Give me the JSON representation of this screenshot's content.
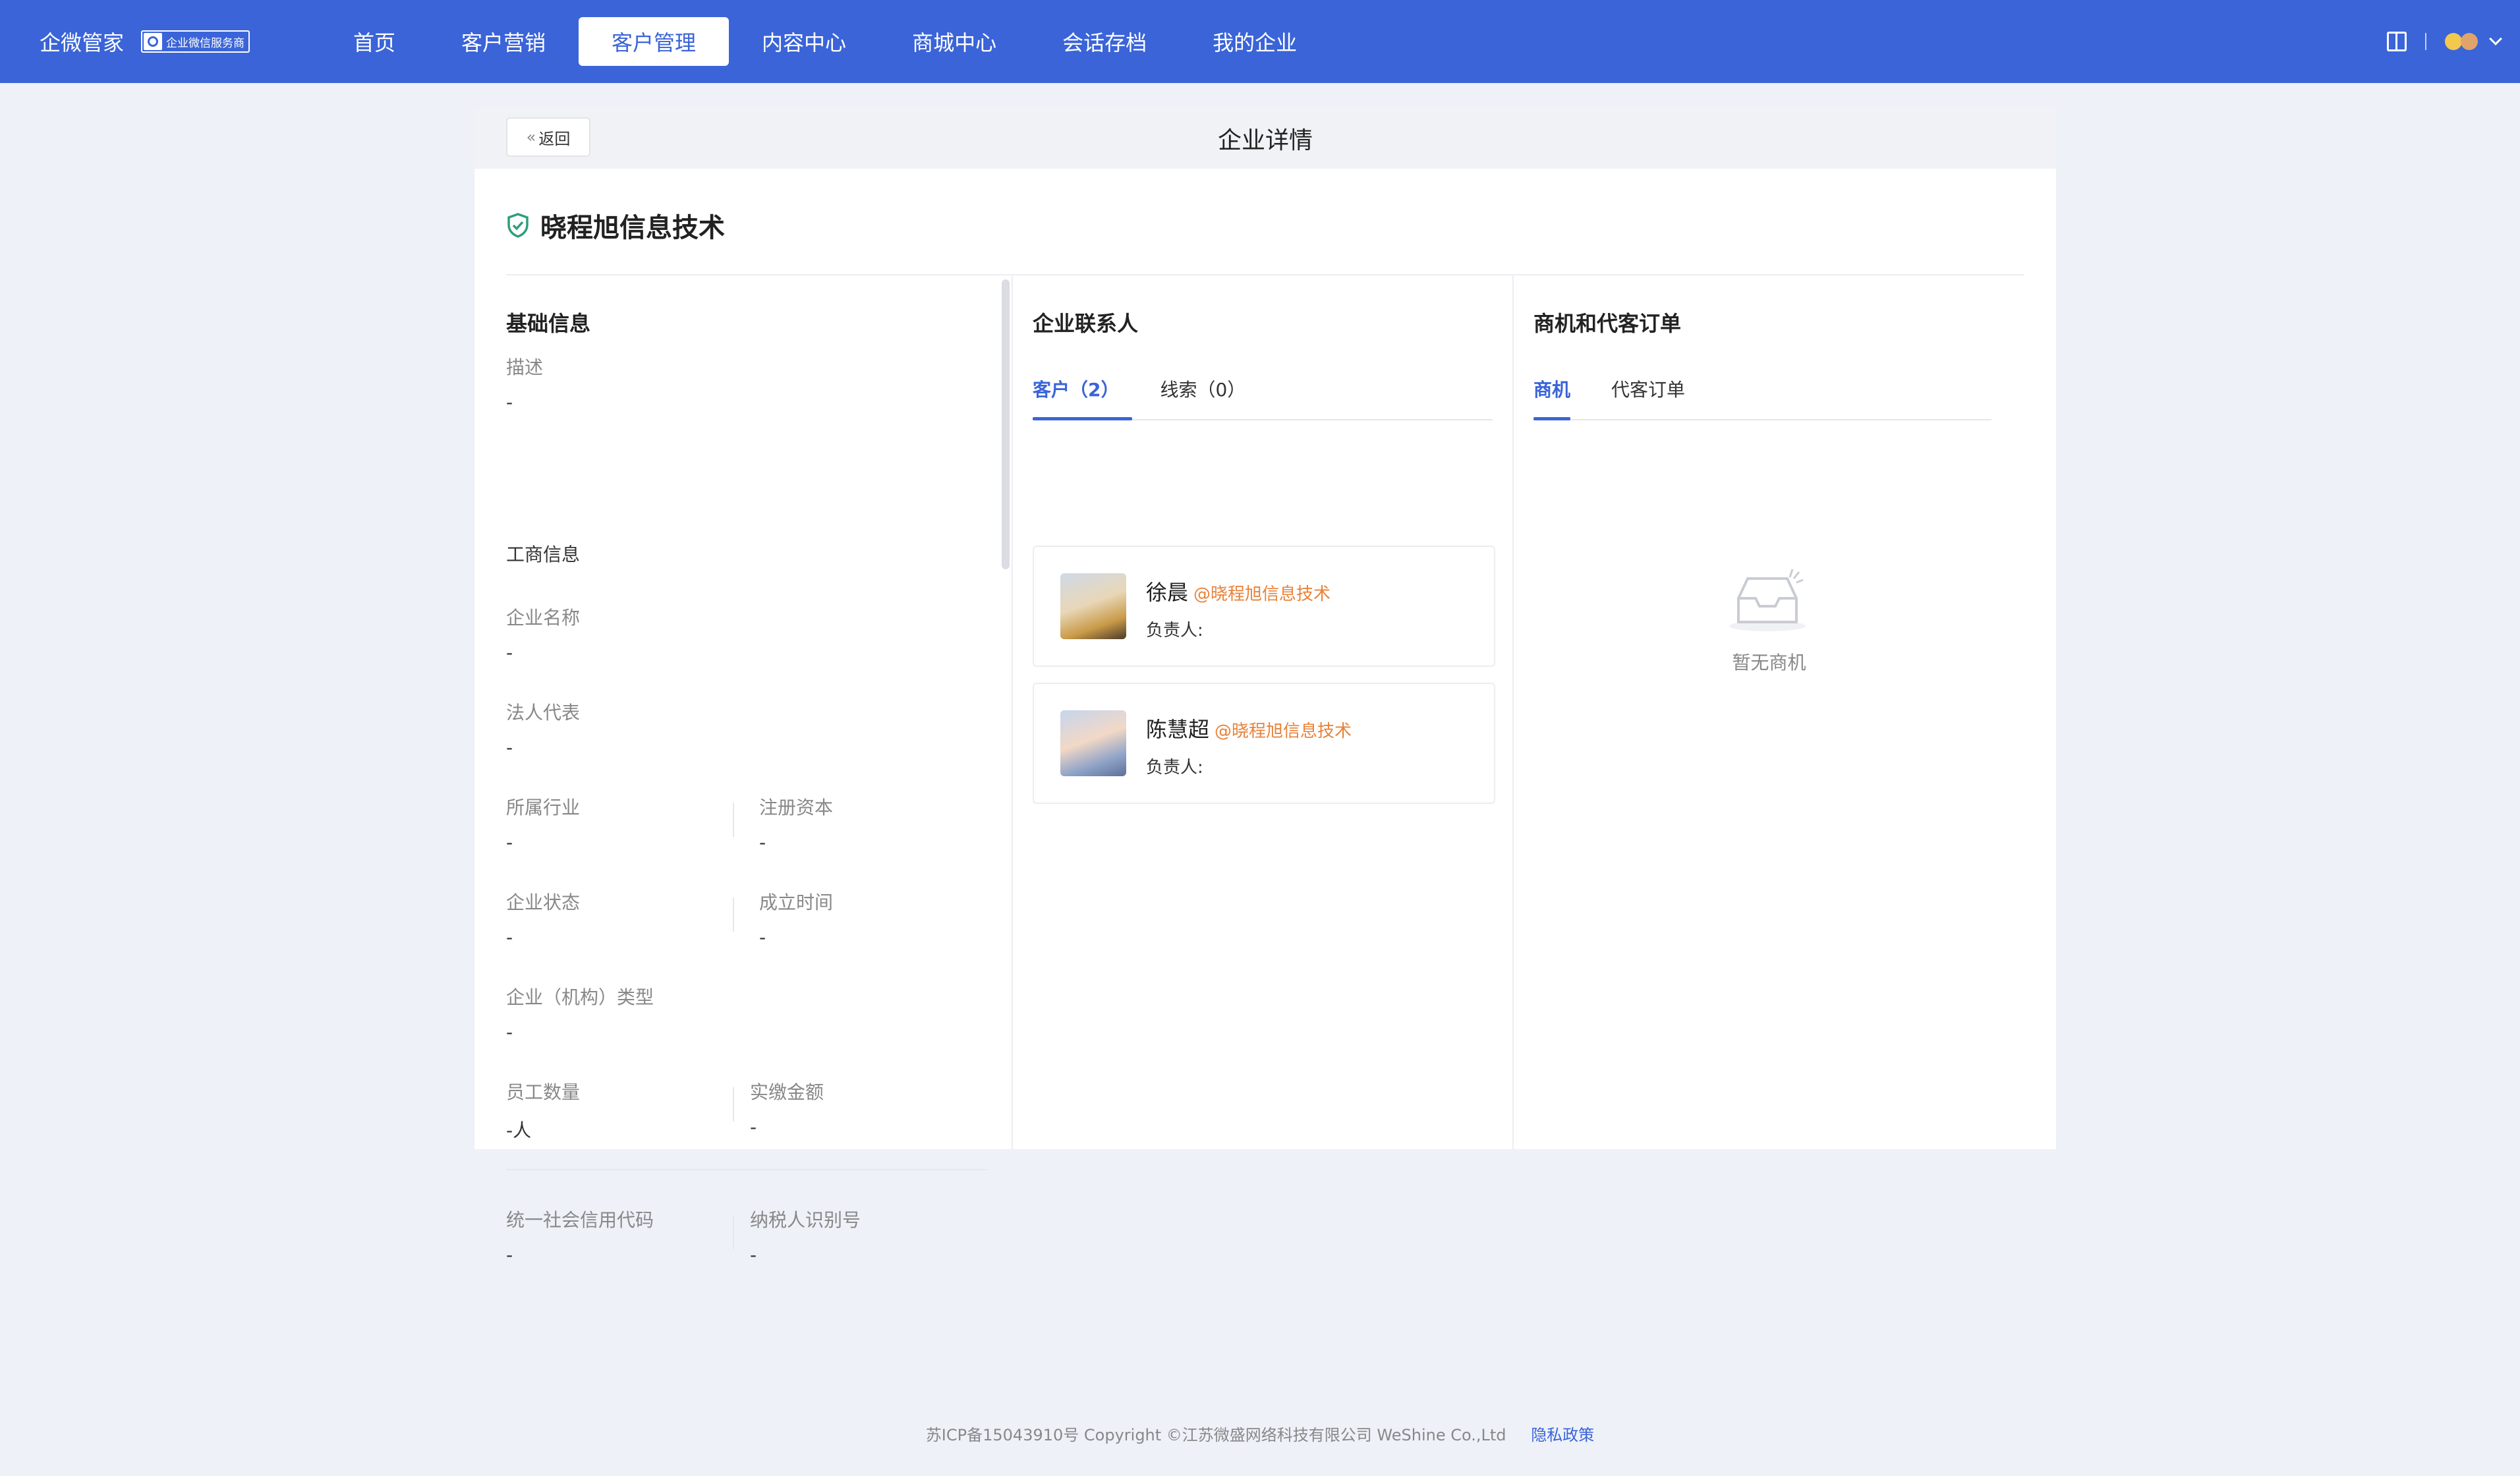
{
  "header": {
    "brand": "企微管家",
    "badge": "企业微信服务商",
    "nav": [
      "首页",
      "客户营销",
      "客户管理",
      "内容中心",
      "商城中心",
      "会话存档",
      "我的企业"
    ],
    "active_nav": "客户管理"
  },
  "page": {
    "back": "返回",
    "title": "企业详情",
    "company_name": "晓程旭信息技术"
  },
  "basic": {
    "title": "基础信息",
    "desc_label": "描述",
    "desc_value": "-",
    "biz_title": "工商信息",
    "name_label": "企业名称",
    "name_value": "-",
    "legal_label": "法人代表",
    "legal_value": "-",
    "industry_label": "所属行业",
    "industry_value": "-",
    "capital_label": "注册资本",
    "capital_value": "-",
    "status_label": "企业状态",
    "status_value": "-",
    "founded_label": "成立时间",
    "founded_value": "-",
    "type_label": "企业（机构）类型",
    "type_value": "-",
    "staff_label": "员工数量",
    "staff_value": "-人",
    "paid_label": "实缴金额",
    "paid_value": "-",
    "credit_label": "统一社会信用代码",
    "credit_value": "-",
    "tax_label": "纳税人识别号",
    "tax_value": "-"
  },
  "contacts": {
    "title": "企业联系人",
    "tabs": [
      "客户（2）",
      "线索（0）"
    ],
    "items": [
      {
        "name": "徐晨",
        "org": "@晓程旭信息技术",
        "owner": "负责人:"
      },
      {
        "name": "陈慧超",
        "org": "@晓程旭信息技术",
        "owner": "负责人:"
      }
    ]
  },
  "deals": {
    "title": "商机和代客订单",
    "tabs": [
      "商机",
      "代客订单"
    ],
    "empty": "暂无商机"
  },
  "footer": {
    "copyright": "苏ICP备15043910号 Copyright ©江苏微盛网络科技有限公司 WeShine Co.,Ltd",
    "privacy": "隐私政策"
  },
  "colors": {
    "primary": "#3a64d8",
    "accent": "#e8823a",
    "success": "#2e9d7c"
  }
}
